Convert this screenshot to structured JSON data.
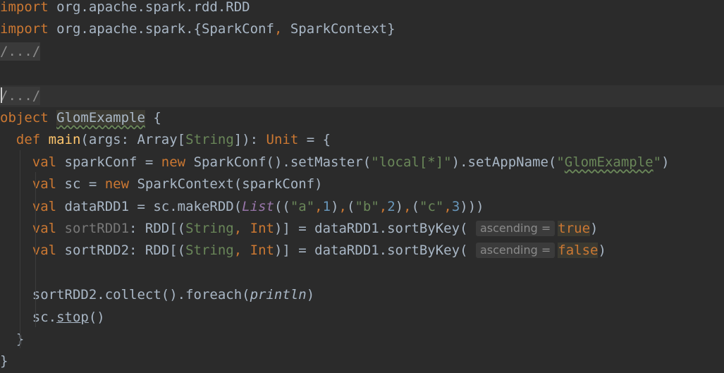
{
  "editor": {
    "lines": [
      [
        {
          "t": "import",
          "c": "k-kw"
        },
        {
          "t": " org.apache.spark.rdd.RDD",
          "c": "k-plain"
        }
      ],
      [
        {
          "t": "import",
          "c": "k-kw"
        },
        {
          "t": " org.apache.spark.{SparkConf",
          "c": "k-plain"
        },
        {
          "t": ",",
          "c": "k-kw"
        },
        {
          "t": " SparkContext}",
          "c": "k-plain"
        }
      ],
      [
        {
          "t": "/.../",
          "c": "fold"
        }
      ],
      [],
      [
        {
          "t": "/.../",
          "c": "fold"
        }
      ],
      [
        {
          "t": "object ",
          "c": "k-kw"
        },
        {
          "t": "GlomExample",
          "c": "k-plain hl-bg squig"
        },
        {
          "t": " {",
          "c": "k-plain"
        }
      ],
      [
        {
          "t": "  def ",
          "c": "k-kw"
        },
        {
          "t": "main",
          "c": "k-fn"
        },
        {
          "t": "(args: Array[",
          "c": "k-plain"
        },
        {
          "t": "String",
          "c": "k-type"
        },
        {
          "t": "]): ",
          "c": "k-plain"
        },
        {
          "t": "Unit",
          "c": "k-kw"
        },
        {
          "t": " = {",
          "c": "k-plain"
        }
      ],
      [
        {
          "t": "    val ",
          "c": "k-kw"
        },
        {
          "t": "sparkConf = ",
          "c": "k-plain"
        },
        {
          "t": "new ",
          "c": "k-kw"
        },
        {
          "t": "SparkConf().setMaster(",
          "c": "k-plain"
        },
        {
          "t": "\"local[*]\"",
          "c": "k-str"
        },
        {
          "t": ").setAppName(",
          "c": "k-plain"
        },
        {
          "t": "\"",
          "c": "k-str"
        },
        {
          "t": "GlomExample",
          "c": "k-str squig"
        },
        {
          "t": "\"",
          "c": "k-str"
        },
        {
          "t": ")",
          "c": "k-plain"
        }
      ],
      [
        {
          "t": "    val ",
          "c": "k-kw"
        },
        {
          "t": "sc = ",
          "c": "k-plain"
        },
        {
          "t": "new ",
          "c": "k-kw"
        },
        {
          "t": "SparkContext(sparkConf)",
          "c": "k-plain"
        }
      ],
      [
        {
          "t": "    val ",
          "c": "k-kw"
        },
        {
          "t": "dataRDD1 = sc.makeRDD(",
          "c": "k-plain"
        },
        {
          "t": "List",
          "c": "k-list"
        },
        {
          "t": "((",
          "c": "k-plain"
        },
        {
          "t": "\"a\"",
          "c": "k-str"
        },
        {
          "t": ",",
          "c": "k-kw"
        },
        {
          "t": "1",
          "c": "k-num"
        },
        {
          "t": ")",
          "c": "k-plain"
        },
        {
          "t": ",",
          "c": "k-kw"
        },
        {
          "t": "(",
          "c": "k-plain"
        },
        {
          "t": "\"b\"",
          "c": "k-str"
        },
        {
          "t": ",",
          "c": "k-kw"
        },
        {
          "t": "2",
          "c": "k-num"
        },
        {
          "t": ")",
          "c": "k-plain"
        },
        {
          "t": ",",
          "c": "k-kw"
        },
        {
          "t": "(",
          "c": "k-plain"
        },
        {
          "t": "\"c\"",
          "c": "k-str"
        },
        {
          "t": ",",
          "c": "k-kw"
        },
        {
          "t": "3",
          "c": "k-num"
        },
        {
          "t": ")))",
          "c": "k-plain"
        }
      ],
      [
        {
          "t": "    val ",
          "c": "k-kw"
        },
        {
          "t": "sortRDD1",
          "c": "k-gray"
        },
        {
          "t": ": RDD[(",
          "c": "k-plain"
        },
        {
          "t": "String",
          "c": "k-type"
        },
        {
          "t": ", ",
          "c": "k-kw"
        },
        {
          "t": "Int",
          "c": "k-kw"
        },
        {
          "t": ")] = dataRDD1.sortByKey( ",
          "c": "k-plain"
        },
        {
          "t": "ascending =",
          "c": "hint"
        },
        {
          "t": "true",
          "c": "k-kw hl-bg"
        },
        {
          "t": ")",
          "c": "k-plain"
        }
      ],
      [
        {
          "t": "    val ",
          "c": "k-kw"
        },
        {
          "t": "sortRDD2: RDD[(",
          "c": "k-plain"
        },
        {
          "t": "String",
          "c": "k-type"
        },
        {
          "t": ", ",
          "c": "k-kw"
        },
        {
          "t": "Int",
          "c": "k-kw"
        },
        {
          "t": ")] = dataRDD1.sortByKey( ",
          "c": "k-plain"
        },
        {
          "t": "ascending =",
          "c": "hint"
        },
        {
          "t": "false",
          "c": "k-kw hl-bg"
        },
        {
          "t": ")",
          "c": "k-plain"
        }
      ],
      [],
      [
        {
          "t": "    sortRDD2.collect().foreach(",
          "c": "k-plain"
        },
        {
          "t": "println",
          "c": "k-plain k-italic"
        },
        {
          "t": ")",
          "c": "k-plain"
        }
      ],
      [
        {
          "t": "    sc.",
          "c": "k-plain"
        },
        {
          "t": "stop",
          "c": "k-plain k-under"
        },
        {
          "t": "()",
          "c": "k-plain"
        }
      ],
      [
        {
          "t": "  }",
          "c": "k-plain"
        }
      ],
      [
        {
          "t": "}",
          "c": "k-plain"
        }
      ]
    ]
  }
}
